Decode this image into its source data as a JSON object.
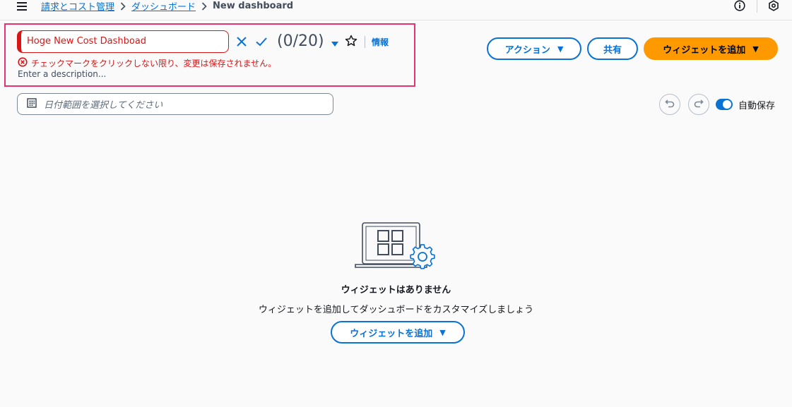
{
  "breadcrumbs": [
    {
      "label": "請求とコスト管理"
    },
    {
      "label": "ダッシュボード"
    },
    {
      "label": "New dashboard"
    }
  ],
  "header_icons": [
    "info-circle-icon",
    "settings-hex-icon"
  ],
  "title_edit": {
    "value": "Hoge New Cost Dashboad",
    "counter": "(0/20)",
    "info_label": "情報",
    "error_text": "チェックマークをクリックしない限り、変更は保存されません。",
    "description_placeholder": "Enter a description..."
  },
  "actions": {
    "action_label": "アクション",
    "share_label": "共有",
    "add_widget_label": "ウィジェットを追加"
  },
  "date_range": {
    "placeholder": "日付範囲を選択してください"
  },
  "autosave": {
    "label": "自動保存",
    "enabled": true
  },
  "empty_state": {
    "title": "ウィジェットはありません",
    "subtitle": "ウィジェットを追加してダッシュボードをカスタマイズしましょう",
    "button_label": "ウィジェットを追加"
  },
  "colors": {
    "accent": "#0972d3",
    "primary": "#ff9900",
    "error": "#d91515",
    "highlight_border": "#e5336e"
  }
}
